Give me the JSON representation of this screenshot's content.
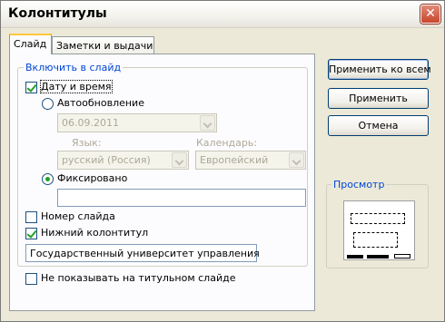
{
  "window": {
    "title": "Колонтитулы"
  },
  "tabs": [
    {
      "label": "Слайд",
      "active": true
    },
    {
      "label": "Заметки и выдачи",
      "active": false
    }
  ],
  "slide_tab": {
    "group_title": "Включить в слайд",
    "date_time": {
      "label": "Дату и время",
      "checked": true
    },
    "auto_update": {
      "label": "Автообновление",
      "selected": false
    },
    "date_format": {
      "value": "06.09.2011"
    },
    "language": {
      "label": "Язык:",
      "value": "русский (Россия)"
    },
    "calendar": {
      "label": "Календарь:",
      "value": "Европейский"
    },
    "fixed": {
      "label": "Фиксировано",
      "selected": true,
      "value": ""
    },
    "slide_number": {
      "label": "Номер слайда",
      "checked": false
    },
    "footer": {
      "label": "Нижний колонтитул",
      "checked": true,
      "value": "Государственный университет управления"
    },
    "hide_on_title": {
      "label": "Не показывать на титульном слайде",
      "checked": false
    }
  },
  "buttons": {
    "apply_all": "Применить ко всем",
    "apply": "Применить",
    "cancel": "Отмена"
  },
  "preview": {
    "title": "Просмотр"
  },
  "icons": {
    "close": "close-icon",
    "dropdown": "chevron-down-icon"
  },
  "colors": {
    "legend": "#0046d5",
    "check": "#21a121",
    "title_bar": "#f3f2ec",
    "close_button": "#c8452b"
  }
}
